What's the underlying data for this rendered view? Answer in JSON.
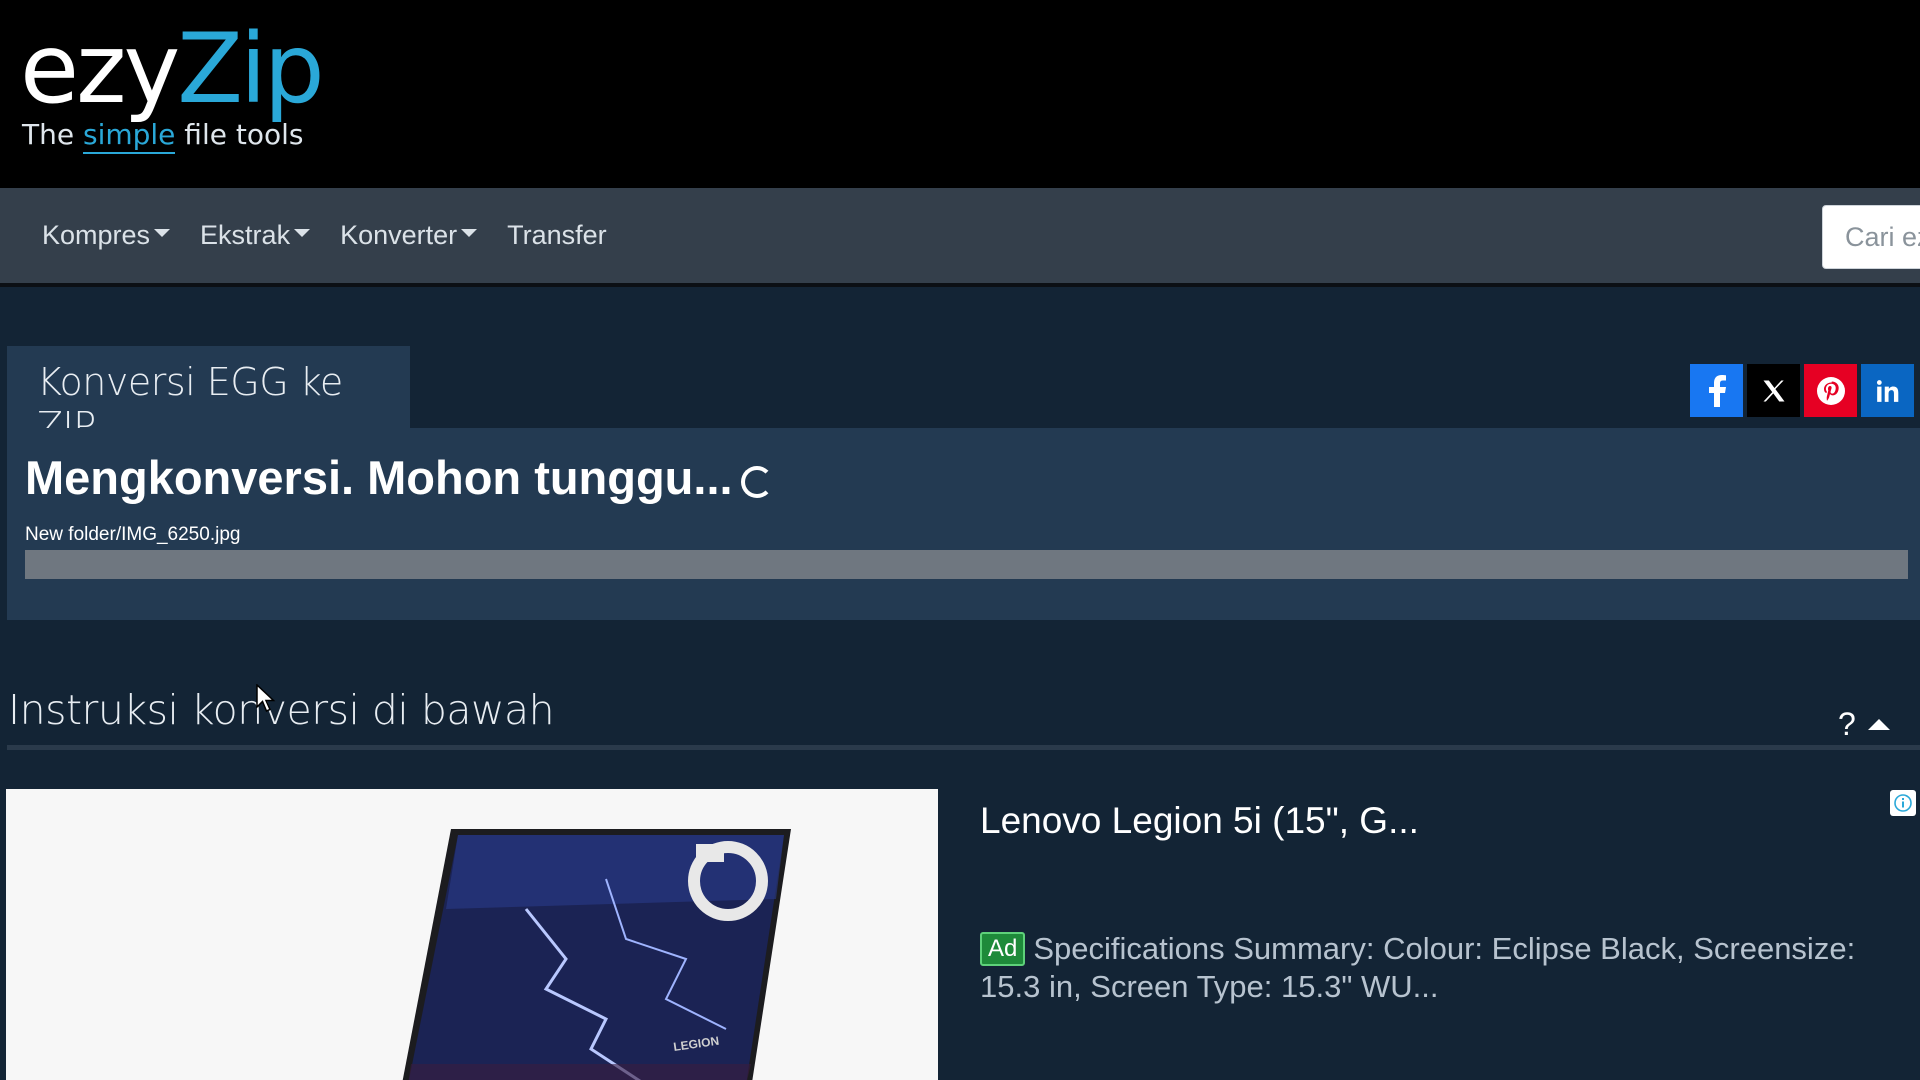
{
  "logo": {
    "part1": "ezy",
    "part2": "Zip",
    "tagline_before": "The ",
    "tagline_highlight": "simple",
    "tagline_after": " file tools"
  },
  "nav": {
    "items": [
      {
        "label": "Kompres",
        "dropdown": true
      },
      {
        "label": "Ekstrak",
        "dropdown": true
      },
      {
        "label": "Konverter",
        "dropdown": true
      },
      {
        "label": "Transfer",
        "dropdown": false
      }
    ],
    "search_placeholder": "Cari ezyZip"
  },
  "main": {
    "tab_title": "Konversi EGG ke ZIP",
    "status_title": "Mengkonversi. Mohon tunggu...",
    "file_name": "New folder/IMG_6250.jpg",
    "progress": 0
  },
  "social": [
    "facebook-icon",
    "x-icon",
    "pinterest-icon",
    "linkedin-icon"
  ],
  "instructions": {
    "title": "Instruksi konversi di bawah",
    "help": "?"
  },
  "ad": {
    "title": "Lenovo Legion 5i (15\", G...",
    "badge": "Ad",
    "text": "Specifications Summary: Colour: Eclipse Black, Screensize: 15.3 in, Screen Type: 15.3\" WU...",
    "image_brand": "LEGION"
  },
  "colors": {
    "accent": "#2aa8d8",
    "page_bg": "#132435",
    "panel_bg": "#233a52",
    "nav_bg": "#343f4b"
  }
}
